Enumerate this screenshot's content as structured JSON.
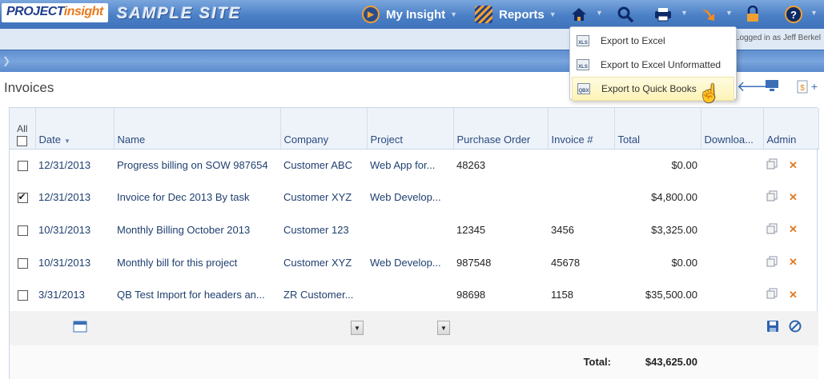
{
  "header": {
    "logo_project": "PROJECT",
    "logo_insight": "insight",
    "site_name": "SAMPLE SITE",
    "nav": [
      {
        "label": "My Insight"
      },
      {
        "label": "Reports"
      }
    ],
    "logged_in": "Logged in as Jeff Berkel"
  },
  "export_menu": {
    "items": [
      {
        "label": "Export to Excel",
        "icon": "XLS"
      },
      {
        "label": "Export to Excel Unformatted",
        "icon": "XLS"
      },
      {
        "label": "Export to Quick Books",
        "icon": "QBX"
      }
    ]
  },
  "page": {
    "title": "Invoices"
  },
  "table": {
    "all_label": "All",
    "columns": {
      "date": "Date",
      "name": "Name",
      "company": "Company",
      "project": "Project",
      "po": "Purchase Order",
      "invoice": "Invoice #",
      "total": "Total",
      "download": "Downloa...",
      "admin": "Admin"
    },
    "rows": [
      {
        "checked": false,
        "date": "12/31/2013",
        "name": "Progress billing on SOW 987654",
        "company": "Customer ABC",
        "project": "Web App for...",
        "po": "48263",
        "invoice": "",
        "total": "$0.00"
      },
      {
        "checked": true,
        "date": "12/31/2013",
        "name": "Invoice for Dec 2013 By task",
        "company": "Customer XYZ",
        "project": "Web Develop...",
        "po": "",
        "invoice": "",
        "total": "$4,800.00"
      },
      {
        "checked": false,
        "date": "10/31/2013",
        "name": "Monthly Billing October 2013",
        "company": "Customer 123",
        "project": "",
        "po": "12345",
        "invoice": "3456",
        "total": "$3,325.00"
      },
      {
        "checked": false,
        "date": "10/31/2013",
        "name": "Monthly bill for this project",
        "company": "Customer XYZ",
        "project": "Web Develop...",
        "po": "987548",
        "invoice": "45678",
        "total": "$0.00"
      },
      {
        "checked": false,
        "date": "3/31/2013",
        "name": "QB Test Import for headers an...",
        "company": "ZR Customer...",
        "project": "",
        "po": "98698",
        "invoice": "1158",
        "total": "$35,500.00"
      }
    ],
    "total_label": "Total:",
    "total_value": "$43,625.00"
  }
}
